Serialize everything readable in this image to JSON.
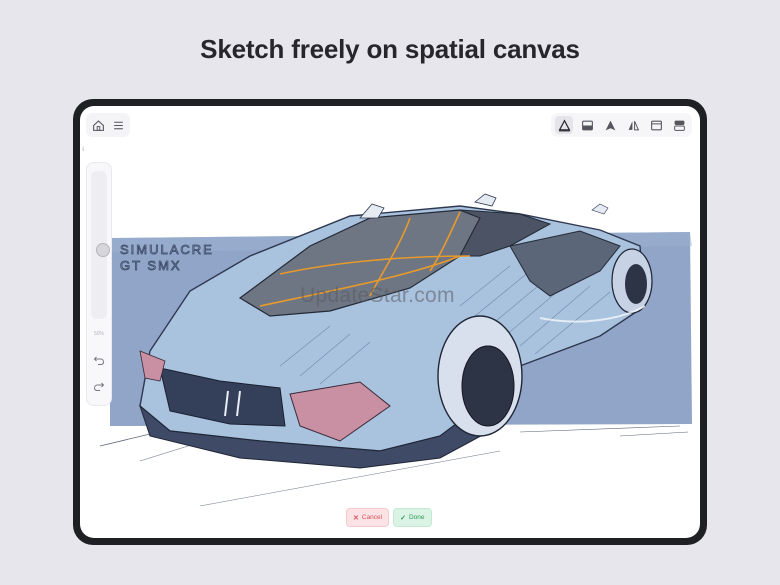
{
  "headline": "Sketch freely on spatial canvas",
  "toolbar_left": [
    {
      "icon": "home-icon"
    },
    {
      "icon": "menu-icon"
    }
  ],
  "toolbar_right": [
    {
      "icon": "pen-tool-icon",
      "active": true
    },
    {
      "icon": "layer-icon",
      "active": false
    },
    {
      "icon": "fill-triangle-icon",
      "active": false
    },
    {
      "icon": "mirror-icon",
      "active": false
    },
    {
      "icon": "window-icon",
      "active": false
    },
    {
      "icon": "panels-icon",
      "active": false
    }
  ],
  "sidebar": {
    "slider_value_percent": 50,
    "slider_label": "50%",
    "undo_icon": "undo-icon",
    "redo_icon": "redo-icon"
  },
  "canvas": {
    "sketch_lettering": "SIMULACRE GT SMX"
  },
  "watermark": "UpdateStar.com",
  "actions": {
    "cancel_label": "Cancel",
    "done_label": "Done"
  },
  "colors": {
    "background": "#e6e6ec",
    "device_frame": "#1f2024",
    "sketch_blue": "#7891b8",
    "accent_orange": "#e89a2a",
    "taillight_pink": "#c98fa2",
    "cancel_red": "#d8545e",
    "done_green": "#2f9c5c"
  }
}
